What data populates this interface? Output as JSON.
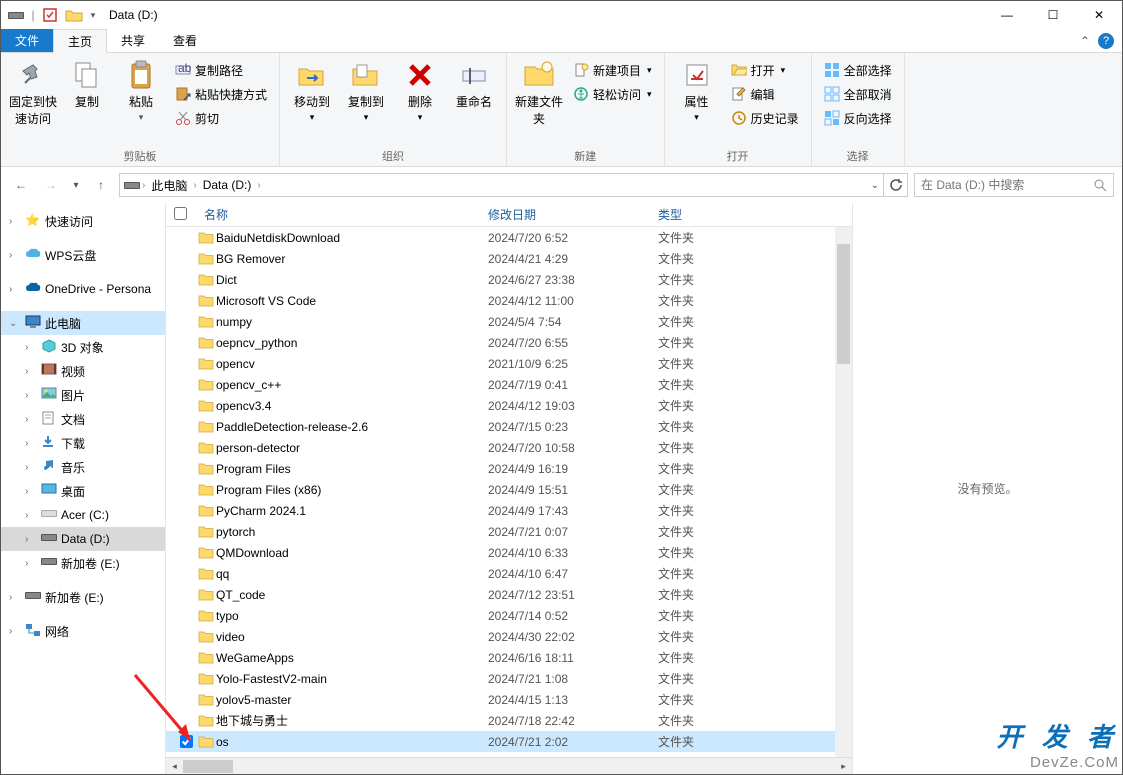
{
  "window": {
    "title": "Data (D:)",
    "min": "—",
    "max": "☐",
    "close": "✕"
  },
  "ribbon": {
    "tabs": {
      "file": "文件",
      "home": "主页",
      "share": "共享",
      "view": "查看"
    },
    "pin_label": "固定到快速访问",
    "copy": "复制",
    "paste": "粘贴",
    "copy_path": "复制路径",
    "paste_shortcut": "粘贴快捷方式",
    "cut": "剪切",
    "group_clipboard": "剪贴板",
    "move_to": "移动到",
    "copy_to": "复制到",
    "delete": "删除",
    "rename": "重命名",
    "group_organize": "组织",
    "new_folder": "新建文件夹",
    "new_item": "新建项目",
    "easy_access": "轻松访问",
    "group_new": "新建",
    "properties": "属性",
    "open": "打开",
    "edit": "编辑",
    "history": "历史记录",
    "group_open": "打开",
    "select_all": "全部选择",
    "select_none": "全部取消",
    "invert": "反向选择",
    "group_select": "选择"
  },
  "address": {
    "this_pc": "此电脑",
    "location": "Data (D:)",
    "search_placeholder": "在 Data (D:) 中搜索"
  },
  "sidebar": {
    "quick": "快速访问",
    "wps": "WPS云盘",
    "onedrive": "OneDrive - Persona",
    "this_pc": "此电脑",
    "objects3d": "3D 对象",
    "videos": "视频",
    "pictures": "图片",
    "documents": "文档",
    "downloads": "下载",
    "music": "音乐",
    "desktop": "桌面",
    "acer": "Acer (C:)",
    "data": "Data (D:)",
    "vol1": "新加卷 (E:)",
    "vol2": "新加卷 (E:)",
    "network": "网络"
  },
  "columns": {
    "name": "名称",
    "date": "修改日期",
    "type": "类型"
  },
  "files": [
    {
      "name": "BaiduNetdiskDownload",
      "date": "2024/7/20 6:52",
      "type": "文件夹"
    },
    {
      "name": "BG Remover",
      "date": "2024/4/21 4:29",
      "type": "文件夹"
    },
    {
      "name": "Dict",
      "date": "2024/6/27 23:38",
      "type": "文件夹"
    },
    {
      "name": "Microsoft VS Code",
      "date": "2024/4/12 11:00",
      "type": "文件夹"
    },
    {
      "name": "numpy",
      "date": "2024/5/4 7:54",
      "type": "文件夹"
    },
    {
      "name": "oepncv_python",
      "date": "2024/7/20 6:55",
      "type": "文件夹"
    },
    {
      "name": "opencv",
      "date": "2021/10/9 6:25",
      "type": "文件夹"
    },
    {
      "name": "opencv_c++",
      "date": "2024/7/19 0:41",
      "type": "文件夹"
    },
    {
      "name": "opencv3.4",
      "date": "2024/4/12 19:03",
      "type": "文件夹"
    },
    {
      "name": "PaddleDetection-release-2.6",
      "date": "2024/7/15 0:23",
      "type": "文件夹"
    },
    {
      "name": "person-detector",
      "date": "2024/7/20 10:58",
      "type": "文件夹"
    },
    {
      "name": "Program Files",
      "date": "2024/4/9 16:19",
      "type": "文件夹"
    },
    {
      "name": "Program Files (x86)",
      "date": "2024/4/9 15:51",
      "type": "文件夹"
    },
    {
      "name": "PyCharm 2024.1",
      "date": "2024/4/9 17:43",
      "type": "文件夹"
    },
    {
      "name": "pytorch",
      "date": "2024/7/21 0:07",
      "type": "文件夹"
    },
    {
      "name": "QMDownload",
      "date": "2024/4/10 6:33",
      "type": "文件夹"
    },
    {
      "name": "qq",
      "date": "2024/4/10 6:47",
      "type": "文件夹"
    },
    {
      "name": "QT_code",
      "date": "2024/7/12 23:51",
      "type": "文件夹"
    },
    {
      "name": "typo",
      "date": "2024/7/14 0:52",
      "type": "文件夹"
    },
    {
      "name": "video",
      "date": "2024/4/30 22:02",
      "type": "文件夹"
    },
    {
      "name": "WeGameApps",
      "date": "2024/6/16 18:11",
      "type": "文件夹"
    },
    {
      "name": "Yolo-FastestV2-main",
      "date": "2024/7/21 1:08",
      "type": "文件夹"
    },
    {
      "name": "yolov5-master",
      "date": "2024/4/15 1:13",
      "type": "文件夹"
    },
    {
      "name": "地下城与勇士",
      "date": "2024/7/18 22:42",
      "type": "文件夹"
    },
    {
      "name": "os",
      "date": "2024/7/21 2:02",
      "type": "文件夹",
      "selected": true
    }
  ],
  "preview": {
    "empty": "没有预览。"
  },
  "watermark": {
    "line1": "开 发 者",
    "line2": "DevZe.CoM"
  }
}
